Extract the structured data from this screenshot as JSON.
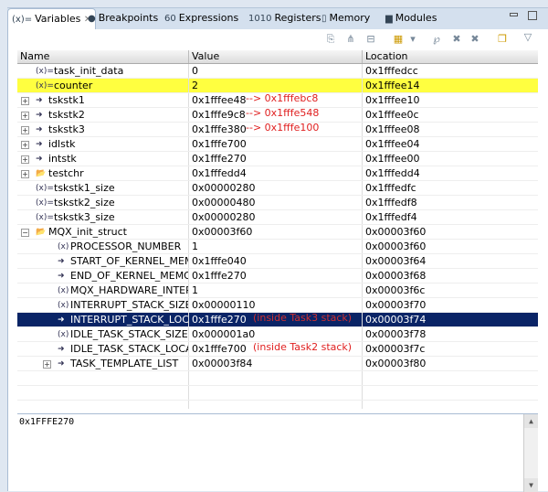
{
  "tabs": [
    {
      "label": "Variables",
      "icon": "variables-icon",
      "active": true
    },
    {
      "label": "Breakpoints",
      "icon": "breakpoints-icon"
    },
    {
      "label": "Expressions",
      "icon": "expressions-icon"
    },
    {
      "label": "Registers",
      "icon": "registers-icon"
    },
    {
      "label": "Memory",
      "icon": "memory-icon"
    },
    {
      "label": "Modules",
      "icon": "modules-icon"
    }
  ],
  "columns": [
    "Name",
    "Value",
    "Location"
  ],
  "rows": [
    {
      "name": "task_init_data",
      "value": "0",
      "location": "0x1fffedcc",
      "indent": 0,
      "icon": "variable-icon"
    },
    {
      "name": "counter",
      "value": "2",
      "location": "0x1fffee14",
      "indent": 0,
      "icon": "variable-icon",
      "highlight": "yellow"
    },
    {
      "name": "tskstk1",
      "value": "0x1fffee48",
      "location": "0x1fffee10",
      "indent": 0,
      "icon": "pointer-icon",
      "expand": "+",
      "note": "--> 0x1fffebc8"
    },
    {
      "name": "tskstk2",
      "value": "0x1fffe9c8",
      "location": "0x1fffee0c",
      "indent": 0,
      "icon": "pointer-icon",
      "expand": "+",
      "note": "--> 0x1fffe548"
    },
    {
      "name": "tskstk3",
      "value": "0x1fffe380",
      "location": "0x1fffee08",
      "indent": 0,
      "icon": "pointer-icon",
      "expand": "+",
      "note": "--> 0x1fffe100"
    },
    {
      "name": "idlstk",
      "value": "0x1fffe700",
      "location": "0x1fffee04",
      "indent": 0,
      "icon": "pointer-icon",
      "expand": "+"
    },
    {
      "name": "intstk",
      "value": "0x1fffe270",
      "location": "0x1fffee00",
      "indent": 0,
      "icon": "pointer-icon",
      "expand": "+"
    },
    {
      "name": "testchr",
      "value": "0x1fffedd4",
      "location": "0x1fffedd4",
      "indent": 0,
      "icon": "struct-icon",
      "expand": "+"
    },
    {
      "name": "tskstk1_size",
      "value": "0x00000280",
      "location": "0x1fffedfc",
      "indent": 0,
      "icon": "variable-icon"
    },
    {
      "name": "tskstk2_size",
      "value": "0x00000480",
      "location": "0x1fffedf8",
      "indent": 0,
      "icon": "variable-icon"
    },
    {
      "name": "tskstk3_size",
      "value": "0x00000280",
      "location": "0x1fffedf4",
      "indent": 0,
      "icon": "variable-icon"
    },
    {
      "name": "MQX_init_struct",
      "value": "0x00003f60",
      "location": "0x00003f60",
      "indent": 0,
      "icon": "struct-icon",
      "expand": "-"
    },
    {
      "name": "PROCESSOR_NUMBER",
      "value": "1",
      "location": "0x00003f60",
      "indent": 1,
      "icon": "field-icon"
    },
    {
      "name": "START_OF_KERNEL_MEMORY",
      "value": "0x1fffe040",
      "location": "0x00003f64",
      "indent": 1,
      "icon": "pointer-field-icon"
    },
    {
      "name": "END_OF_KERNEL_MEMORY",
      "value": "0x1fffe270",
      "location": "0x00003f68",
      "indent": 1,
      "icon": "pointer-field-icon"
    },
    {
      "name": "MQX_HARDWARE_INTERRUPT_LEVEL_MAX",
      "value": "1",
      "location": "0x00003f6c",
      "indent": 1,
      "icon": "field-icon"
    },
    {
      "name": "INTERRUPT_STACK_SIZE",
      "value": "0x00000110",
      "location": "0x00003f70",
      "indent": 1,
      "icon": "field-icon"
    },
    {
      "name": "INTERRUPT_STACK_LOCATION",
      "value": "0x1fffe270",
      "location": "0x00003f74",
      "indent": 1,
      "icon": "pointer-field-icon",
      "highlight": "selected",
      "note": "(inside Task3 stack)"
    },
    {
      "name": "IDLE_TASK_STACK_SIZE",
      "value": "0x000001a0",
      "location": "0x00003f78",
      "indent": 1,
      "icon": "field-icon"
    },
    {
      "name": "IDLE_TASK_STACK_LOCATION",
      "value": "0x1fffe700",
      "location": "0x00003f7c",
      "indent": 1,
      "icon": "pointer-field-icon",
      "note": "(inside Task2 stack)"
    },
    {
      "name": "TASK_TEMPLATE_LIST",
      "value": "0x00003f84",
      "location": "0x00003f80",
      "indent": 1,
      "icon": "pointer-field-icon",
      "expand": "+"
    }
  ],
  "detail": {
    "text": "0x1FFFE270"
  },
  "colors": {
    "selected": "#0a2466",
    "highlight": "#ffff40",
    "note": "#e02020"
  }
}
